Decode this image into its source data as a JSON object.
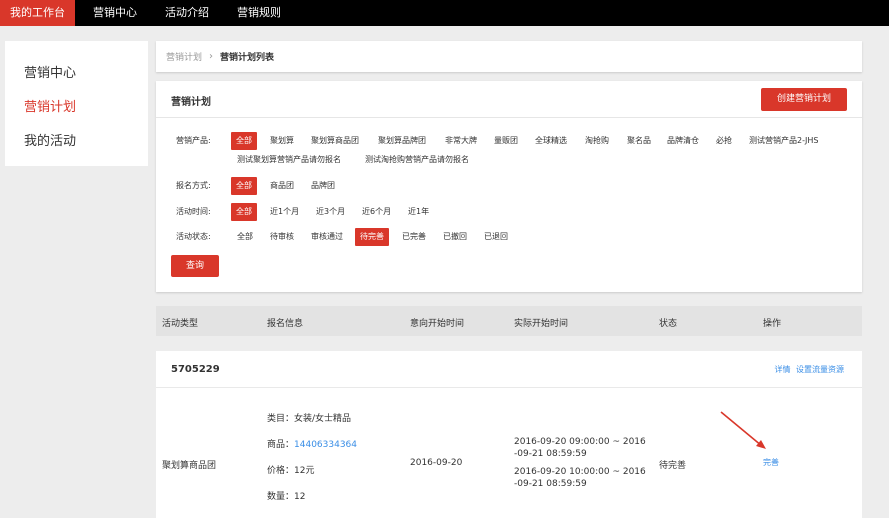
{
  "topnav": {
    "tabs": [
      {
        "label": "我的工作台"
      },
      {
        "label": "营销中心"
      },
      {
        "label": "活动介绍"
      },
      {
        "label": "营销规则"
      }
    ]
  },
  "sidebar": {
    "items": [
      {
        "label": "营销中心"
      },
      {
        "label": "营销计划"
      },
      {
        "label": "我的活动"
      }
    ]
  },
  "breadcrumb": {
    "parent": "营销计划",
    "current": "营销计划列表"
  },
  "panel": {
    "title": "营销计划",
    "create_label": "创建营销计划",
    "query_label": "查询"
  },
  "filters": {
    "product": {
      "label": "营销产品:",
      "options": [
        "全部",
        "聚划算",
        "聚划算商品团",
        "聚划算品牌团",
        "非常大牌",
        "量贩团",
        "全球精选",
        "淘抢购",
        "聚名品",
        "品牌清仓",
        "必抢",
        "测试营销产品2-JHS",
        "测试聚划算营销产品请勿报名",
        "测试淘抢购营销产品请勿报名"
      ]
    },
    "signup": {
      "label": "报名方式:",
      "options": [
        "全部",
        "商品团",
        "品牌团"
      ]
    },
    "time": {
      "label": "活动时间:",
      "options": [
        "全部",
        "近1个月",
        "近3个月",
        "近6个月",
        "近1年"
      ]
    },
    "status": {
      "label": "活动状态:",
      "options": [
        "全部",
        "待审核",
        "审核通过",
        "待完善",
        "已完善",
        "已撤回",
        "已退回"
      ]
    }
  },
  "table": {
    "headers": [
      "活动类型",
      "报名信息",
      "意向开始时间",
      "实际开始时间",
      "状态",
      "操作"
    ]
  },
  "record": {
    "id": "5705229",
    "detail_label": "详情",
    "traffic_label": "设置流量资源",
    "type": "聚划算商品团",
    "category_label": "类目：",
    "category_value": "女装/女士精品",
    "product_label": "商品：",
    "product_value": "14406334364",
    "price_label": "价格：",
    "price_value": "12元",
    "qty_label": "数量：",
    "qty_value": "12",
    "intended_start": "2016-09-20",
    "actual_range_1a": "2016-09-20 09:00:00 ~ 2016",
    "actual_range_1b": "-09-21 08:59:59",
    "actual_range_2a": "2016-09-20 10:00:00 ~ 2016",
    "actual_range_2b": "-09-21 08:59:59",
    "status": "待完善",
    "action_label": "完善"
  },
  "colors": {
    "accent": "#d9372a",
    "link": "#3a8ee6",
    "topbar": "#000000"
  }
}
